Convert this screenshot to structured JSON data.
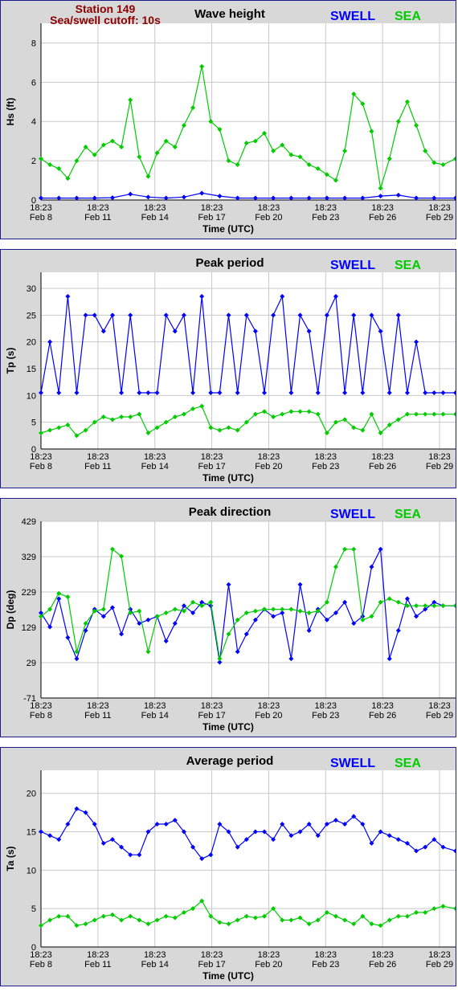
{
  "header": {
    "station": "Station 149",
    "cutoff": "Sea/swell cutoff: 10s"
  },
  "legend": {
    "swell": "SWELL",
    "sea": "SEA"
  },
  "colors": {
    "swell": "#0000ff",
    "sea": "#00cc00",
    "frame": "#1a1a8c",
    "station": "#8b0000"
  },
  "x_ticks": [
    {
      "time": "18:23",
      "date": "Feb 8"
    },
    {
      "time": "18:23",
      "date": "Feb 11"
    },
    {
      "time": "18:23",
      "date": "Feb 14"
    },
    {
      "time": "18:23",
      "date": "Feb 17"
    },
    {
      "time": "18:23",
      "date": "Feb 20"
    },
    {
      "time": "18:23",
      "date": "Feb 23"
    },
    {
      "time": "18:23",
      "date": "Feb 26"
    },
    {
      "time": "18:23",
      "date": "Feb 29"
    }
  ],
  "chart_data": [
    {
      "type": "line",
      "title": "Wave height",
      "xlabel": "Time (UTC)",
      "ylabel": "Hs (ft)",
      "ylim": [
        0,
        9
      ],
      "yticks": [
        0,
        2,
        4,
        6,
        8
      ],
      "xlim": [
        0,
        23.2
      ],
      "grid": true,
      "legend_position": "top-right",
      "series": [
        {
          "name": "SWELL",
          "x": [
            0,
            1,
            2,
            3,
            4,
            5,
            6,
            7,
            8,
            9,
            10,
            11,
            12,
            13,
            14,
            15,
            16,
            17,
            18,
            19,
            20,
            21,
            22,
            23.2
          ],
          "values": [
            0.1,
            0.1,
            0.1,
            0.1,
            0.12,
            0.3,
            0.15,
            0.1,
            0.15,
            0.35,
            0.2,
            0.1,
            0.1,
            0.1,
            0.1,
            0.1,
            0.1,
            0.1,
            0.1,
            0.2,
            0.25,
            0.1,
            0.1,
            0.1
          ]
        },
        {
          "name": "SEA",
          "x": [
            0,
            0.5,
            1,
            1.5,
            2,
            2.5,
            3,
            3.5,
            4,
            4.5,
            5,
            5.5,
            6,
            6.5,
            7,
            7.5,
            8,
            8.5,
            9,
            9.5,
            10,
            10.5,
            11,
            11.5,
            12,
            12.5,
            13,
            13.5,
            14,
            14.5,
            15,
            15.5,
            16,
            16.5,
            17,
            17.5,
            18,
            18.5,
            19,
            19.5,
            20,
            20.5,
            21,
            21.5,
            22,
            22.5,
            23.2
          ],
          "values": [
            2.1,
            1.8,
            1.6,
            1.1,
            2.0,
            2.7,
            2.3,
            2.8,
            3.0,
            2.7,
            5.1,
            2.2,
            1.2,
            2.4,
            3.0,
            2.7,
            3.8,
            4.7,
            6.8,
            4.0,
            3.6,
            2.0,
            1.8,
            2.9,
            3.0,
            3.4,
            2.5,
            2.8,
            2.3,
            2.2,
            1.8,
            1.6,
            1.3,
            1.0,
            2.5,
            5.4,
            4.9,
            3.5,
            0.6,
            2.1,
            4.0,
            5.0,
            3.8,
            2.5,
            1.9,
            1.8,
            2.1
          ]
        }
      ]
    },
    {
      "type": "line",
      "title": "Peak period",
      "xlabel": "Time (UTC)",
      "ylabel": "Tp (s)",
      "ylim": [
        0,
        33
      ],
      "yticks": [
        0,
        5,
        10,
        15,
        20,
        25,
        30
      ],
      "xlim": [
        0,
        23.2
      ],
      "grid": true,
      "legend_position": "top-right",
      "series": [
        {
          "name": "SWELL",
          "x": [
            0,
            0.5,
            1,
            1.5,
            2,
            2.5,
            3,
            3.5,
            4,
            4.5,
            5,
            5.5,
            6,
            6.5,
            7,
            7.5,
            8,
            8.5,
            9,
            9.5,
            10,
            10.5,
            11,
            11.5,
            12,
            12.5,
            13,
            13.5,
            14,
            14.5,
            15,
            15.5,
            16,
            16.5,
            17,
            17.5,
            18,
            18.5,
            19,
            19.5,
            20,
            20.5,
            21,
            21.5,
            22,
            22.5,
            23.2
          ],
          "values": [
            10.5,
            20,
            10.5,
            28.5,
            10.5,
            25,
            25,
            22,
            25,
            10.5,
            25,
            10.5,
            10.5,
            10.5,
            25,
            22,
            25,
            10.5,
            28.5,
            10.5,
            10.5,
            25,
            10.5,
            25,
            22,
            10.5,
            25,
            28.5,
            10.5,
            25,
            22,
            10.5,
            25,
            28.5,
            10.5,
            25,
            10.5,
            25,
            22,
            10.5,
            25,
            10.5,
            20,
            10.5,
            10.5,
            10.5,
            10.5
          ]
        },
        {
          "name": "SEA",
          "x": [
            0,
            0.5,
            1,
            1.5,
            2,
            2.5,
            3,
            3.5,
            4,
            4.5,
            5,
            5.5,
            6,
            6.5,
            7,
            7.5,
            8,
            8.5,
            9,
            9.5,
            10,
            10.5,
            11,
            11.5,
            12,
            12.5,
            13,
            13.5,
            14,
            14.5,
            15,
            15.5,
            16,
            16.5,
            17,
            17.5,
            18,
            18.5,
            19,
            19.5,
            20,
            20.5,
            21,
            21.5,
            22,
            22.5,
            23.2
          ],
          "values": [
            3.0,
            3.5,
            4.0,
            4.5,
            2.5,
            3.5,
            5.0,
            6.0,
            5.5,
            6.0,
            6.0,
            6.5,
            3.0,
            4.0,
            5.0,
            6.0,
            6.5,
            7.5,
            8.0,
            4.0,
            3.5,
            4.0,
            3.5,
            5.0,
            6.5,
            7.0,
            6.0,
            6.5,
            7.0,
            7.0,
            7.0,
            6.5,
            3.0,
            5.0,
            5.5,
            4.0,
            3.5,
            6.5,
            3.0,
            4.5,
            5.5,
            6.5,
            6.5,
            6.5,
            6.5,
            6.5,
            6.5
          ]
        }
      ]
    },
    {
      "type": "line",
      "title": "Peak direction",
      "xlabel": "Time (UTC)",
      "ylabel": "Dp (deg)",
      "ylim": [
        -71,
        429
      ],
      "yticks": [
        -71,
        29,
        129,
        229,
        329,
        429
      ],
      "xlim": [
        0,
        23.2
      ],
      "grid": true,
      "legend_position": "top-right",
      "series": [
        {
          "name": "SWELL",
          "x": [
            0,
            0.5,
            1,
            1.5,
            2,
            2.5,
            3,
            3.5,
            4,
            4.5,
            5,
            5.5,
            6,
            6.5,
            7,
            7.5,
            8,
            8.5,
            9,
            9.5,
            10,
            10.5,
            11,
            11.5,
            12,
            12.5,
            13,
            13.5,
            14,
            14.5,
            15,
            15.5,
            16,
            16.5,
            17,
            17.5,
            18,
            18.5,
            19,
            19.5,
            20,
            20.5,
            21,
            21.5,
            22,
            22.5,
            23.2
          ],
          "values": [
            170,
            130,
            210,
            100,
            40,
            120,
            180,
            160,
            185,
            110,
            180,
            140,
            150,
            160,
            90,
            140,
            190,
            170,
            200,
            190,
            30,
            250,
            60,
            110,
            150,
            180,
            160,
            170,
            40,
            250,
            120,
            180,
            150,
            170,
            200,
            140,
            160,
            300,
            350,
            40,
            120,
            210,
            160,
            180,
            200,
            190,
            190
          ]
        },
        {
          "name": "SEA",
          "x": [
            0,
            0.5,
            1,
            1.5,
            2,
            2.5,
            3,
            3.5,
            4,
            4.5,
            5,
            5.5,
            6,
            6.5,
            7,
            7.5,
            8,
            8.5,
            9,
            9.5,
            10,
            10.5,
            11,
            11.5,
            12,
            12.5,
            13,
            13.5,
            14,
            14.5,
            15,
            15.5,
            16,
            16.5,
            17,
            17.5,
            18,
            18.5,
            19,
            19.5,
            20,
            20.5,
            21,
            21.5,
            22,
            22.5,
            23.2
          ],
          "values": [
            160,
            180,
            225,
            215,
            60,
            140,
            175,
            180,
            350,
            330,
            170,
            175,
            60,
            160,
            170,
            180,
            175,
            200,
            190,
            200,
            40,
            110,
            150,
            170,
            175,
            180,
            180,
            180,
            180,
            175,
            170,
            175,
            200,
            300,
            350,
            350,
            150,
            160,
            200,
            210,
            200,
            190,
            190,
            190,
            190,
            190,
            190
          ]
        }
      ]
    },
    {
      "type": "line",
      "title": "Average period",
      "xlabel": "Time (UTC)",
      "ylabel": "Ta (s)",
      "ylim": [
        0,
        23
      ],
      "yticks": [
        0,
        5,
        10,
        15,
        20
      ],
      "xlim": [
        0,
        23.2
      ],
      "grid": true,
      "legend_position": "top-right",
      "series": [
        {
          "name": "SWELL",
          "x": [
            0,
            0.5,
            1,
            1.5,
            2,
            2.5,
            3,
            3.5,
            4,
            4.5,
            5,
            5.5,
            6,
            6.5,
            7,
            7.5,
            8,
            8.5,
            9,
            9.5,
            10,
            10.5,
            11,
            11.5,
            12,
            12.5,
            13,
            13.5,
            14,
            14.5,
            15,
            15.5,
            16,
            16.5,
            17,
            17.5,
            18,
            18.5,
            19,
            19.5,
            20,
            20.5,
            21,
            21.5,
            22,
            22.5,
            23.2
          ],
          "values": [
            15,
            14.5,
            14,
            16,
            18,
            17.5,
            16,
            13.5,
            14,
            13,
            12,
            12,
            15,
            16,
            16,
            16.5,
            15,
            13,
            11.5,
            12,
            16,
            15,
            13,
            14,
            15,
            15,
            14,
            16,
            14.5,
            15,
            16,
            14.5,
            16,
            16.5,
            16,
            17,
            16,
            13.5,
            15,
            14.5,
            14,
            13.5,
            12.5,
            13,
            14,
            13,
            12.5
          ]
        },
        {
          "name": "SEA",
          "x": [
            0,
            0.5,
            1,
            1.5,
            2,
            2.5,
            3,
            3.5,
            4,
            4.5,
            5,
            5.5,
            6,
            6.5,
            7,
            7.5,
            8,
            8.5,
            9,
            9.5,
            10,
            10.5,
            11,
            11.5,
            12,
            12.5,
            13,
            13.5,
            14,
            14.5,
            15,
            15.5,
            16,
            16.5,
            17,
            17.5,
            18,
            18.5,
            19,
            19.5,
            20,
            20.5,
            21,
            21.5,
            22,
            22.5,
            23.2
          ],
          "values": [
            2.8,
            3.5,
            4.0,
            4.0,
            2.8,
            3.0,
            3.5,
            4.0,
            4.2,
            3.5,
            4.0,
            3.5,
            3.0,
            3.5,
            4.0,
            3.8,
            4.5,
            5.0,
            6.0,
            4.0,
            3.2,
            3.0,
            3.5,
            4.0,
            3.8,
            4.0,
            5.0,
            3.5,
            3.5,
            3.8,
            3.0,
            3.5,
            4.5,
            4.0,
            3.5,
            3.0,
            4.0,
            3.0,
            2.8,
            3.5,
            4.0,
            4.0,
            4.5,
            4.5,
            5.0,
            5.3,
            5.0
          ]
        }
      ]
    }
  ]
}
